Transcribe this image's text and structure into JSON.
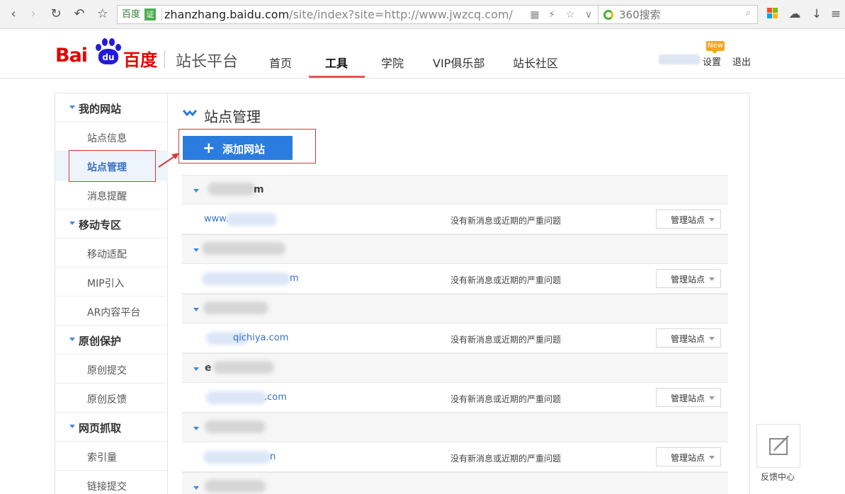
{
  "browser": {
    "address_tag": "百度",
    "cert_badge": "证",
    "url_host": "zhanzhang.baidu.com",
    "url_path": "/site/index?site=http://www.jwzcq.com/",
    "search_placeholder": "360搜索"
  },
  "header": {
    "logo_text_latin": "Bai",
    "logo_text_paw": "du",
    "logo_text_cn": "百度",
    "platform_name": "站长平台",
    "nav": [
      "首页",
      "工具",
      "学院",
      "VIP俱乐部",
      "站长社区"
    ],
    "active_nav": "工具",
    "new_badge": "New",
    "settings_label": "设置",
    "logout_label": "退出"
  },
  "sidebar": {
    "groups": [
      {
        "title": "我的网站",
        "items": [
          "站点信息",
          "站点管理",
          "消息提醒"
        ]
      },
      {
        "title": "移动专区",
        "items": [
          "移动适配",
          "MIP引入",
          "AR内容平台"
        ]
      },
      {
        "title": "原创保护",
        "items": [
          "原创提交",
          "原创反馈"
        ]
      },
      {
        "title": "网页抓取",
        "items": [
          "索引量",
          "链接提交"
        ]
      }
    ],
    "active_item": "站点管理"
  },
  "main": {
    "title": "站点管理",
    "add_button_label": "添加网站",
    "sites": [
      {
        "domain": "m",
        "link": "www.",
        "message": "没有新消息或近期的严重问题",
        "manage_label": "管理站点"
      },
      {
        "domain": "",
        "link": "m",
        "message": "没有新消息或近期的严重问题",
        "manage_label": "管理站点"
      },
      {
        "domain": "",
        "link": "qichiya.com",
        "message": "没有新消息或近期的严重问题",
        "manage_label": "管理站点"
      },
      {
        "domain": "e",
        "link": ".com",
        "message": "没有新消息或近期的严重问题",
        "manage_label": "管理站点"
      },
      {
        "domain": "",
        "link": "n",
        "message": "没有新消息或近期的严重问题",
        "manage_label": "管理站点"
      },
      {
        "domain": "",
        "link": "",
        "message": "",
        "manage_label": ""
      }
    ]
  },
  "feedback": {
    "label": "反馈中心"
  },
  "colors": {
    "accent": "#2b7cdf",
    "brand_red": "#e10601",
    "brand_blue": "#2319dc",
    "nav_underline": "#e55457",
    "highlight_box": "#d9373a"
  }
}
